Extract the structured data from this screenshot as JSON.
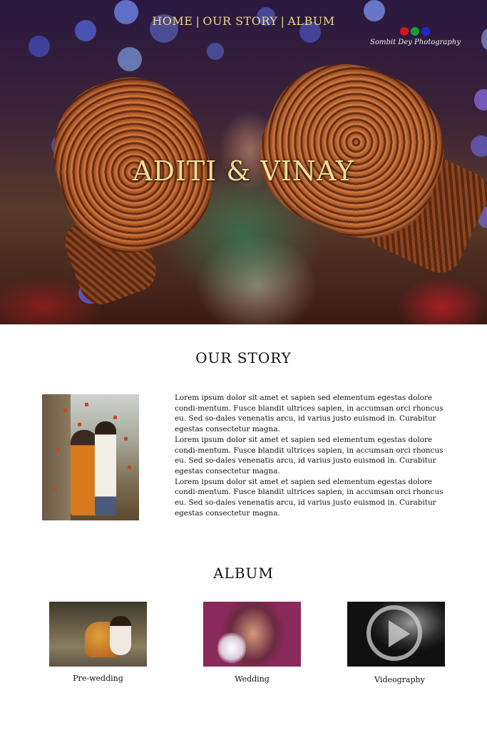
{
  "nav": {
    "items": [
      "HOME",
      "OUR STORY",
      "ALBUM"
    ],
    "separator": "|"
  },
  "logo": {
    "text": "Sombit Dey Photography",
    "dot_colors": [
      "#d0151d",
      "#17a032",
      "#1e2bc6"
    ]
  },
  "hero": {
    "title": "ADITI & VINAY",
    "title_color": "#f2dc9a"
  },
  "story": {
    "heading": "OUR STORY",
    "paragraphs": [
      "Lorem ipsum dolor sit amet et sapien sed elementum egestas dolore condi-mentum. Fusce blandit ultrices sapien, in accumsan orci rhoncus eu. Sed so-dales venenatis arcu, id varius justo euismod in. Curabitur egestas consectetur magna.",
      "Lorem ipsum dolor sit amet et sapien sed elementum egestas dolore condi-mentum. Fusce blandit ultrices sapien, in accumsan orci rhoncus eu. Sed so-dales venenatis arcu, id varius justo euismod in. Curabitur egestas consectetur magna.",
      "Lorem ipsum dolor sit amet et sapien sed elementum egestas dolore condi-mentum. Fusce blandit ultrices sapien, in accumsan orci rhoncus eu. Sed so-dales venenatis arcu, id varius justo euismod in. Curabitur egestas consectetur magna."
    ]
  },
  "album": {
    "heading": "ALBUM",
    "items": [
      {
        "label": "Pre-wedding"
      },
      {
        "label": "Wedding"
      },
      {
        "label": "Videography"
      }
    ]
  }
}
